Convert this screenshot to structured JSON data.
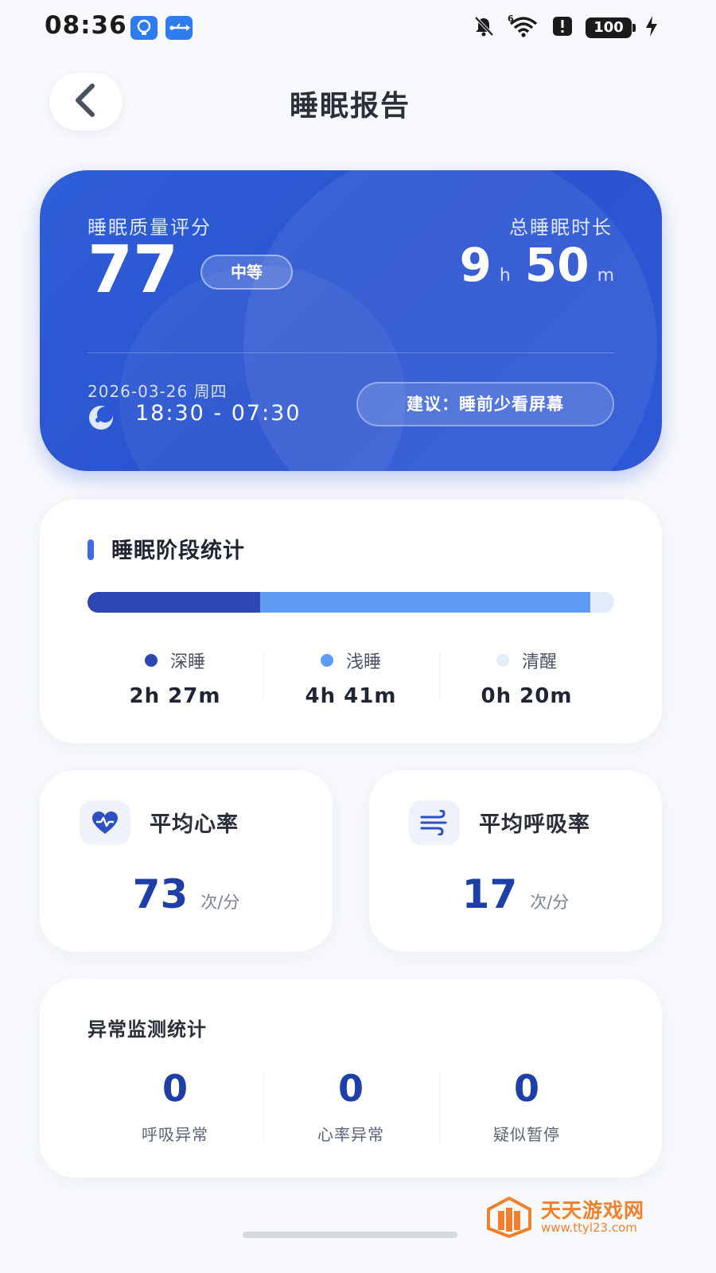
{
  "status_bar": {
    "time": "08:36",
    "left_icons": [
      "lightbulb-icon",
      "usb-icon"
    ],
    "right_icons": [
      "bell-off-icon",
      "wifi-icon",
      "alert-icon",
      "battery-icon",
      "charging-icon"
    ],
    "wifi_badge": "6",
    "battery_level": "100"
  },
  "header": {
    "title": "睡眠报告",
    "back_icon": "chevron-left-icon"
  },
  "summary": {
    "score_label": "睡眠质量评分",
    "score": "77",
    "grade": "中等",
    "duration_label": "总睡眠时长",
    "duration_hours": "9",
    "duration_hours_unit": "h",
    "duration_minutes": "50",
    "duration_minutes_unit": "m",
    "date": "2026-03-26 周四",
    "time_range": "18:30 - 07:30",
    "advice": "建议：睡前少看屏幕"
  },
  "stages": {
    "title": "睡眠阶段统计",
    "items": [
      {
        "label": "深睡",
        "value": "2h 27m",
        "minutes": 147,
        "color": "#2c47b2"
      },
      {
        "label": "浅睡",
        "value": "4h 41m",
        "minutes": 281,
        "color": "#5e9bf2"
      },
      {
        "label": "清醒",
        "value": "0h 20m",
        "minutes": 20,
        "color": "#e3ecfa"
      }
    ]
  },
  "metrics": {
    "heart_rate": {
      "title": "平均心率",
      "value": "73",
      "unit": "次/分",
      "icon": "heart-icon"
    },
    "respiration": {
      "title": "平均呼吸率",
      "value": "17",
      "unit": "次/分",
      "icon": "wind-icon"
    }
  },
  "abnormal": {
    "title": "异常监测统计",
    "items": [
      {
        "value": "0",
        "label": "呼吸异常"
      },
      {
        "value": "0",
        "label": "心率异常"
      },
      {
        "value": "0",
        "label": "疑似暂停"
      }
    ]
  },
  "watermark": {
    "text": "天天游戏网",
    "url": "www.ttyl23.com"
  },
  "colors": {
    "accent": "#2f5fd8",
    "value_blue": "#1e3ea8",
    "watermark": "#f0812a"
  }
}
